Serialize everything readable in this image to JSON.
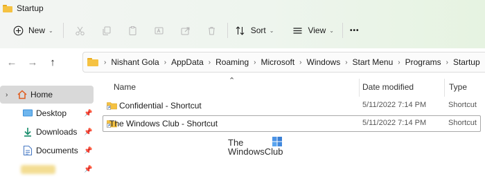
{
  "window": {
    "title": "Startup"
  },
  "toolbar": {
    "new_label": "New",
    "sort_label": "Sort",
    "view_label": "View",
    "more_label": "•••",
    "icons": [
      "cut-icon",
      "copy-icon",
      "paste-icon",
      "rename-icon",
      "share-icon",
      "delete-icon"
    ]
  },
  "address": {
    "crumbs": [
      "Nishant Gola",
      "AppData",
      "Roaming",
      "Microsoft",
      "Windows",
      "Start Menu",
      "Programs",
      "Startup"
    ]
  },
  "sidebar": {
    "items": [
      {
        "label": "Home",
        "icon": "home-icon",
        "selected": true
      },
      {
        "label": "Desktop",
        "icon": "desktop-icon",
        "pinned": true
      },
      {
        "label": "Downloads",
        "icon": "download-icon",
        "pinned": true
      },
      {
        "label": "Documents",
        "icon": "documents-icon",
        "pinned": true
      },
      {
        "label": "",
        "icon": "folder-icon",
        "pinned": true
      }
    ]
  },
  "columns": {
    "name": "Name",
    "date": "Date modified",
    "type": "Type"
  },
  "files": [
    {
      "name": "Confidential - Shortcut",
      "date": "5/11/2022 7:14 PM",
      "type": "Shortcut"
    },
    {
      "name": "The Windows Club - Shortcut",
      "date": "5/11/2022 7:14 PM",
      "type": "Shortcut"
    }
  ],
  "watermark": {
    "line1": "The",
    "line2": "WindowsClub"
  },
  "colors": {
    "folder": "#f5c242",
    "selection": "#d9d9d9",
    "accent": "#0067c0"
  }
}
